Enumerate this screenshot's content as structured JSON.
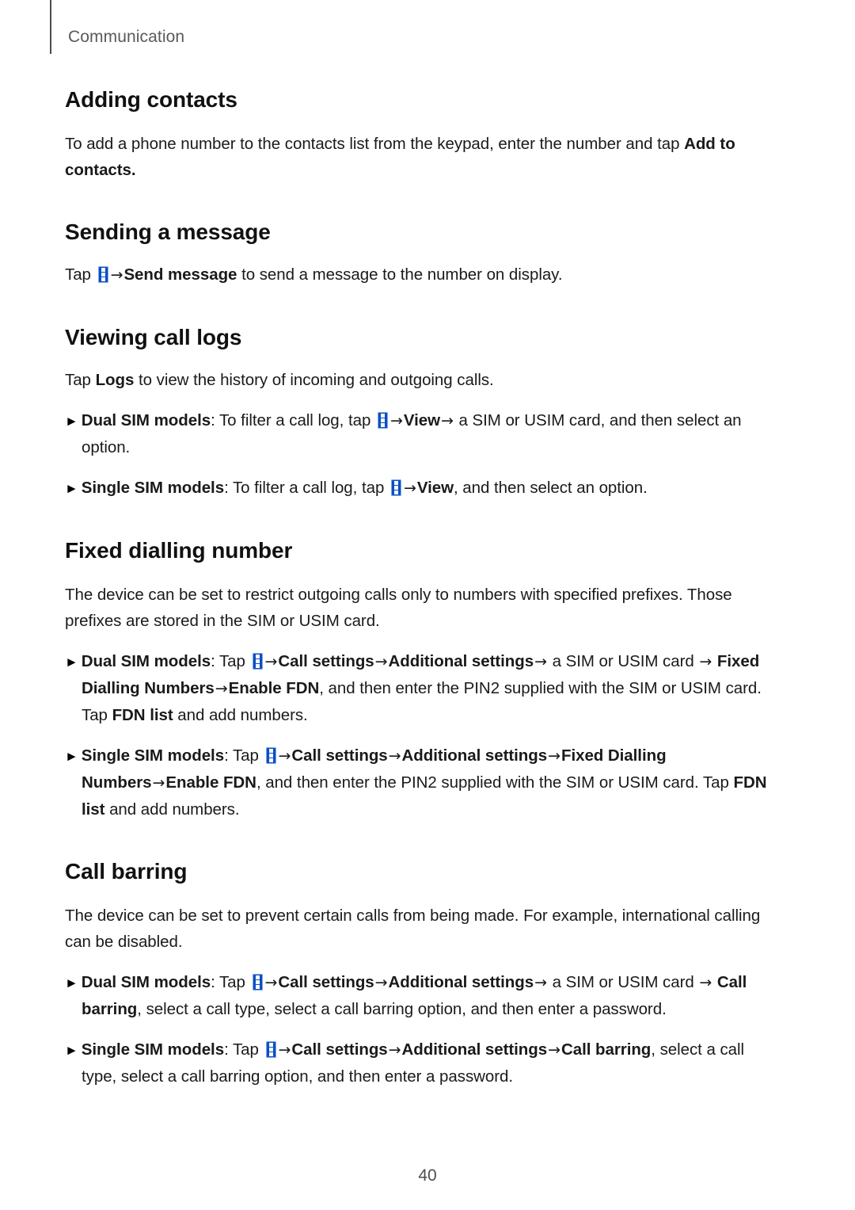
{
  "header": {
    "running_title": "Communication"
  },
  "footer": {
    "page_number": "40"
  },
  "icons": {
    "more_options": "more-options-icon",
    "bullet": "►",
    "arrow": "→"
  },
  "colors": {
    "icon_blue": "#0b4ec4",
    "icon_blue_light": "#7fa8e8",
    "header_gray": "#5a5a5a",
    "body_black": "#1a1a1a"
  },
  "sections": [
    {
      "heading": "Adding contacts",
      "paragraph_1a": "To add a phone number to the contacts list from the keypad, enter the number and tap ",
      "paragraph_1b": "Add to contacts",
      "paragraph_1c": "."
    },
    {
      "heading": "Sending a message",
      "tap_label": "Tap",
      "send_message": "Send message",
      "tail": " to send a message to the number on display."
    },
    {
      "heading": "Viewing call logs",
      "intro_a": "Tap ",
      "intro_b": "Logs",
      "intro_c": " to view the history of incoming and outgoing calls.",
      "dual_label": "Dual SIM models",
      "dual_a": ": To filter a call log, tap ",
      "dual_view": "View",
      "dual_b": " a SIM or USIM card, and then select an option.",
      "single_label": "Single SIM models",
      "single_a": ": To filter a call log, tap ",
      "single_view": "View",
      "single_b": ", and then select an option."
    },
    {
      "heading": "Fixed dialling number",
      "intro": "The device can be set to restrict outgoing calls only to numbers with specified prefixes. Those prefixes are stored in the SIM or USIM card.",
      "dual_label": "Dual SIM models",
      "dual_tap": ": Tap ",
      "dual_call_settings": "Call settings",
      "dual_additional": "Additional settings",
      "dual_sim_text": " a SIM or USIM card ",
      "dual_fdn_numbers": "Fixed Dialling Numbers",
      "dual_enable_fdn": "Enable FDN",
      "dual_tail_1": ", and then enter the PIN2 supplied with the SIM or USIM card. Tap ",
      "dual_fdn_list": "FDN list",
      "dual_tail_2": " and add numbers.",
      "single_label": "Single SIM models",
      "single_tap": ": Tap ",
      "single_call_settings": "Call settings",
      "single_additional": "Additional settings",
      "single_fdn_numbers": "Fixed Dialling Numbers",
      "single_enable_fdn": "Enable FDN",
      "single_tail_1": ", and then enter the PIN2 supplied with the SIM or USIM card. Tap ",
      "single_fdn_list": "FDN list",
      "single_tail_2": " and add numbers."
    },
    {
      "heading": "Call barring",
      "intro": "The device can be set to prevent certain calls from being made. For example, international calling can be disabled.",
      "dual_label": "Dual SIM models",
      "dual_tap": ": Tap ",
      "dual_call_settings": "Call settings",
      "dual_additional": "Additional settings",
      "dual_sim_text": " a SIM or USIM card ",
      "dual_call_barring": "Call barring",
      "dual_tail": ", select a call type, select a call barring option, and then enter a password.",
      "single_label": "Single SIM models",
      "single_tap": ": Tap ",
      "single_call_settings": "Call settings",
      "single_additional": "Additional settings",
      "single_call_barring": "Call barring",
      "single_tail": ", select a call type, select a call barring option, and then enter a password."
    }
  ]
}
